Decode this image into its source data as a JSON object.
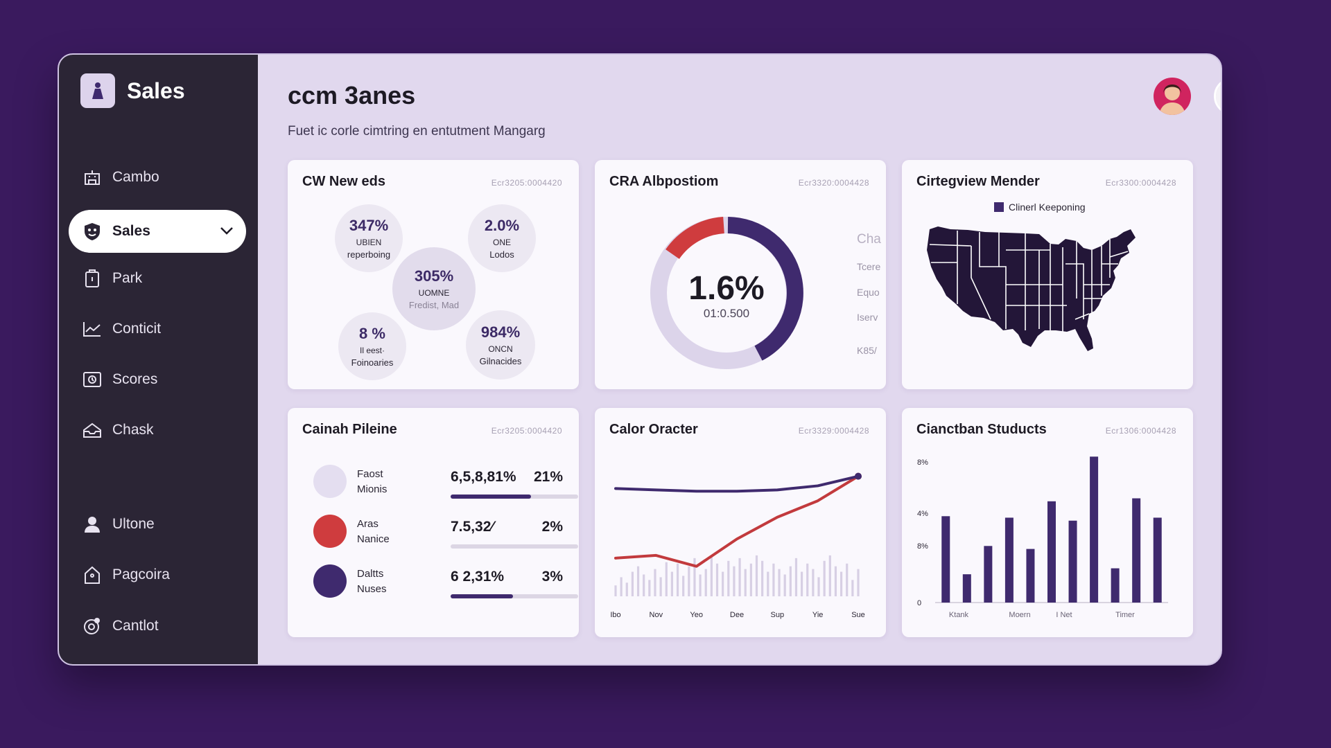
{
  "app": {
    "title": "Sales"
  },
  "sidebar": {
    "items": [
      {
        "label": "Cambo",
        "icon": "building-icon"
      },
      {
        "label": "Sales",
        "icon": "shield-icon",
        "active": true
      },
      {
        "label": "Park",
        "icon": "clipboard-icon"
      },
      {
        "label": "Conticit",
        "icon": "chart-line-icon"
      },
      {
        "label": "Scores",
        "icon": "image-icon"
      },
      {
        "label": "Chask",
        "icon": "inbox-icon"
      },
      {
        "label": "Ultone",
        "icon": "user-icon"
      },
      {
        "label": "Pagcoira",
        "icon": "home-icon"
      },
      {
        "label": "Cantlot",
        "icon": "settings-icon"
      }
    ]
  },
  "header": {
    "title": "ccm 3anes",
    "subtitle": "Fuet ic corle cimtring en entutment Mangarg"
  },
  "cards": {
    "new_eds": {
      "title": "CW New eds",
      "code": "Ecr3205:0004420",
      "bubbles": [
        {
          "pct": "347%",
          "l1": "UBIEN",
          "l2": "reperboing"
        },
        {
          "pct": "2.0%",
          "l1": "ONE",
          "l2": "Lodos"
        },
        {
          "pct": "305%",
          "l1": "UOMNE",
          "l2": "Fredist, Mad"
        },
        {
          "pct": "8 %",
          "l1": "Il eest·",
          "l2": "Foinoaries"
        },
        {
          "pct": "984%",
          "l1": "ONCN",
          "l2": "Gilnacides"
        }
      ]
    },
    "albpostiom": {
      "title": "CRA Albpostiom",
      "code": "Ecr3320:0004428",
      "center_value": "1.6%",
      "center_sub": "01:0.500",
      "legend": [
        "Cha",
        "Tcere",
        "Equo",
        "Iserv",
        "K85/"
      ]
    },
    "mender": {
      "title": "Cirtegview Mender",
      "code": "Ecr3300:0004428",
      "legend_label": "Clinerl Keeponing"
    },
    "pipeline": {
      "title": "Cainah Pileine",
      "code": "Ecr3205:0004420",
      "rows": [
        {
          "label1": "Faost",
          "label2": "Mionis",
          "value": "6,5,8,81%",
          "pct": "21%",
          "progress": 0.63,
          "color": "#e4def0"
        },
        {
          "label1": "Aras",
          "label2": "Nanice",
          "value": "7.5,32⁄",
          "pct": "2%",
          "progress": 0.0,
          "color": "#cf3c3e"
        },
        {
          "label1": "Daltts",
          "label2": "Nuses",
          "value": "6 2,31%",
          "pct": "3%",
          "progress": 0.49,
          "color": "#3f2a6e"
        }
      ]
    },
    "oractter": {
      "title": "Calor Oracter",
      "code": "Ecr3329:0004428",
      "chart_data": {
        "type": "line",
        "categories": [
          "Ibo",
          "Nov",
          "Yeo",
          "Dee",
          "Sup",
          "Yie",
          "Sue"
        ],
        "series": [
          {
            "values": [
              28,
              30,
              22,
              42,
              58,
              70,
              88
            ],
            "color": "#c23a3d"
          },
          {
            "values": [
              79,
              78,
              77,
              77,
              78,
              81,
              88
            ],
            "color": "#3f2a6e"
          }
        ],
        "bars": [
          8,
          14,
          10,
          18,
          22,
          16,
          12,
          20,
          14,
          25,
          18,
          24,
          15,
          22,
          28,
          16,
          20,
          30,
          24,
          18,
          26,
          22,
          28,
          20,
          24,
          30,
          26,
          18,
          24,
          20,
          16,
          22,
          28,
          18,
          24,
          20,
          14,
          26,
          30,
          22,
          18,
          24,
          12,
          20
        ],
        "bar_color": "#d7cfe4",
        "ylim": [
          0,
          100
        ]
      }
    },
    "studucts": {
      "title": "Cianctban Studucts",
      "code": "Ecr1306:0004428",
      "chart_data": {
        "type": "bar",
        "values": [
          58,
          19,
          38,
          57,
          36,
          68,
          55,
          98,
          23,
          70,
          57
        ],
        "categories": [
          "Ktank",
          "Moern",
          "I Net",
          "Timer"
        ],
        "y_ticks": [
          "0",
          "8%",
          "4%",
          "8%"
        ],
        "ylim": [
          0,
          100
        ],
        "color": "#3f2a6e"
      }
    }
  },
  "colors": {
    "accent": "#3f2a6e",
    "red": "#c23a3d",
    "lavender": "#d9d0e8",
    "sidebar": "#2b2535",
    "map": "#231638"
  }
}
